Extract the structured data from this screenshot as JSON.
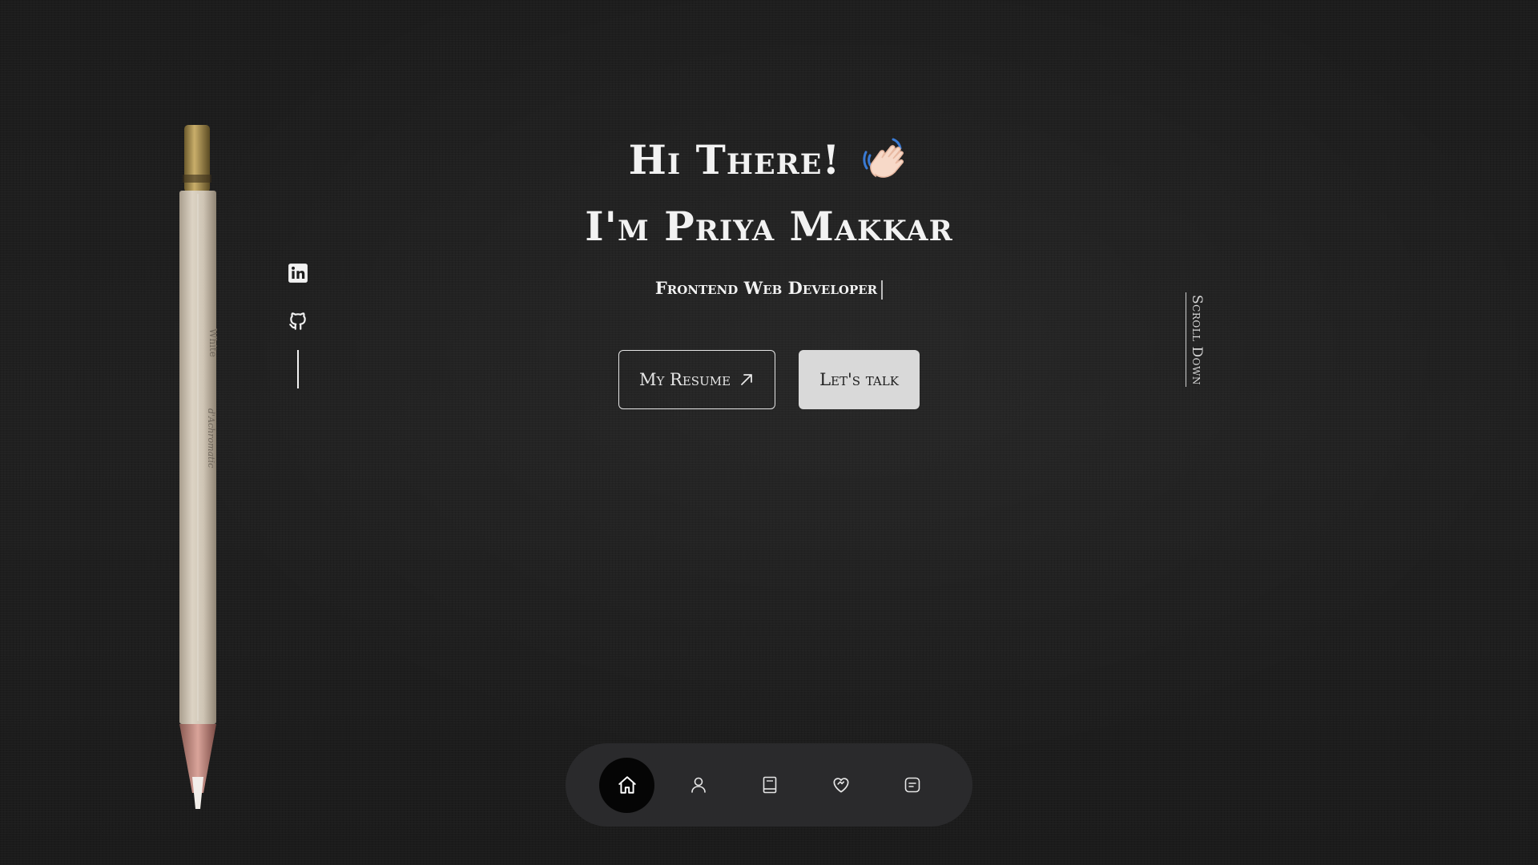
{
  "hero": {
    "greeting": "Hi There!",
    "name": "I'm Priya Makkar",
    "role": "Frontend Web Developer"
  },
  "actions": {
    "resume_label": "My Resume",
    "talk_label": "Let's talk"
  },
  "scroll": {
    "label": "Scroll Down"
  },
  "socials": [
    {
      "icon": "linkedin-icon"
    },
    {
      "icon": "github-icon"
    }
  ],
  "nav": {
    "items": [
      {
        "icon": "home-icon",
        "active": true
      },
      {
        "icon": "user-icon",
        "active": false
      },
      {
        "icon": "book-icon",
        "active": false
      },
      {
        "icon": "heart-handshake-icon",
        "active": false
      },
      {
        "icon": "message-icon",
        "active": false
      }
    ]
  },
  "colors": {
    "background": "#1d1d1d",
    "text": "#f2f2f2",
    "dock": "#2a2a2c",
    "active_nav": "#050505",
    "button_solid": "#d9d9d9"
  }
}
